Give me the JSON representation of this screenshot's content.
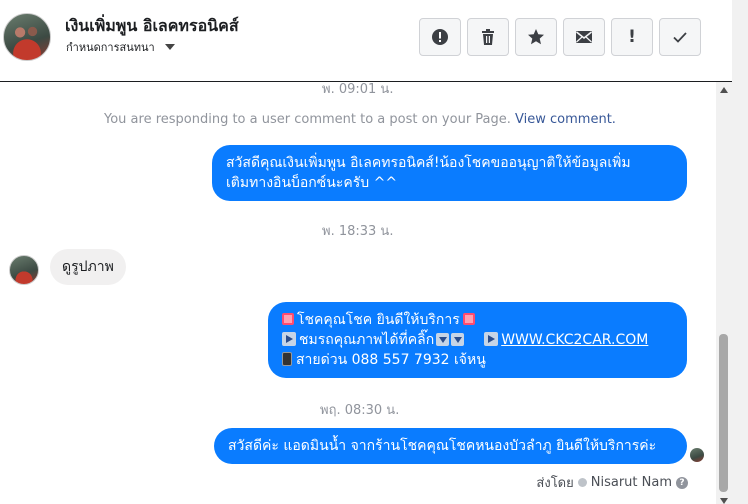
{
  "header": {
    "contact_name": "เงินเพิ่มพูน อิเลคทรอนิคส์",
    "assign_label": "กำหนดการสนทนา",
    "actions": [
      {
        "icon": "alert-icon",
        "label": ""
      },
      {
        "icon": "trash-icon",
        "label": ""
      },
      {
        "icon": "star-icon",
        "label": ""
      },
      {
        "icon": "mail-icon",
        "label": ""
      },
      {
        "icon": "exclamation-icon",
        "label": "!"
      },
      {
        "icon": "checkmark-icon",
        "label": ""
      }
    ]
  },
  "conversation": {
    "timestamp_top": "พ. 09:01 น.",
    "notice_text": "You are responding to a user comment to a post on your Page.",
    "notice_link": "View comment.",
    "msg1_line1": "สวัสดีคุณเงินเพิ่มพูน อิเลคทรอนิคส์!น้องโชคขออนุญาติให้ข้อมูลเพิ่ม",
    "msg1_line2": "เติมทางอินบ็อกซ์นะครับ ^^",
    "timestamp_2": "พ. 18:33 น.",
    "incoming_text": "ดูรูปภาพ",
    "msg2_line1": "โชคคุณโชค ยินดีให้บริการ",
    "msg2_line2a": "ชมรถคุณภาพได้ที่คลิ๊ก",
    "msg2_link": "WWW.CKC2CAR.COM",
    "msg2_line3": "สายด่วน 088 557 7932 เจ้หนู",
    "timestamp_3": "พฤ. 08:30 น.",
    "msg3": "สวัสดีค่ะ แอดมินน้ำ จากร้านโชคคุณโชคหนองบัวลำภู ยินดีให้บริการค่ะ",
    "sent_by_label": "ส่งโดย",
    "sent_by_name": "Nisarut Nam",
    "help_glyph": "?"
  },
  "colors": {
    "outgoing_bubble": "#0a7cff",
    "incoming_bubble": "#f1f0f0",
    "link": "#385898",
    "meta_text": "#90949c"
  }
}
